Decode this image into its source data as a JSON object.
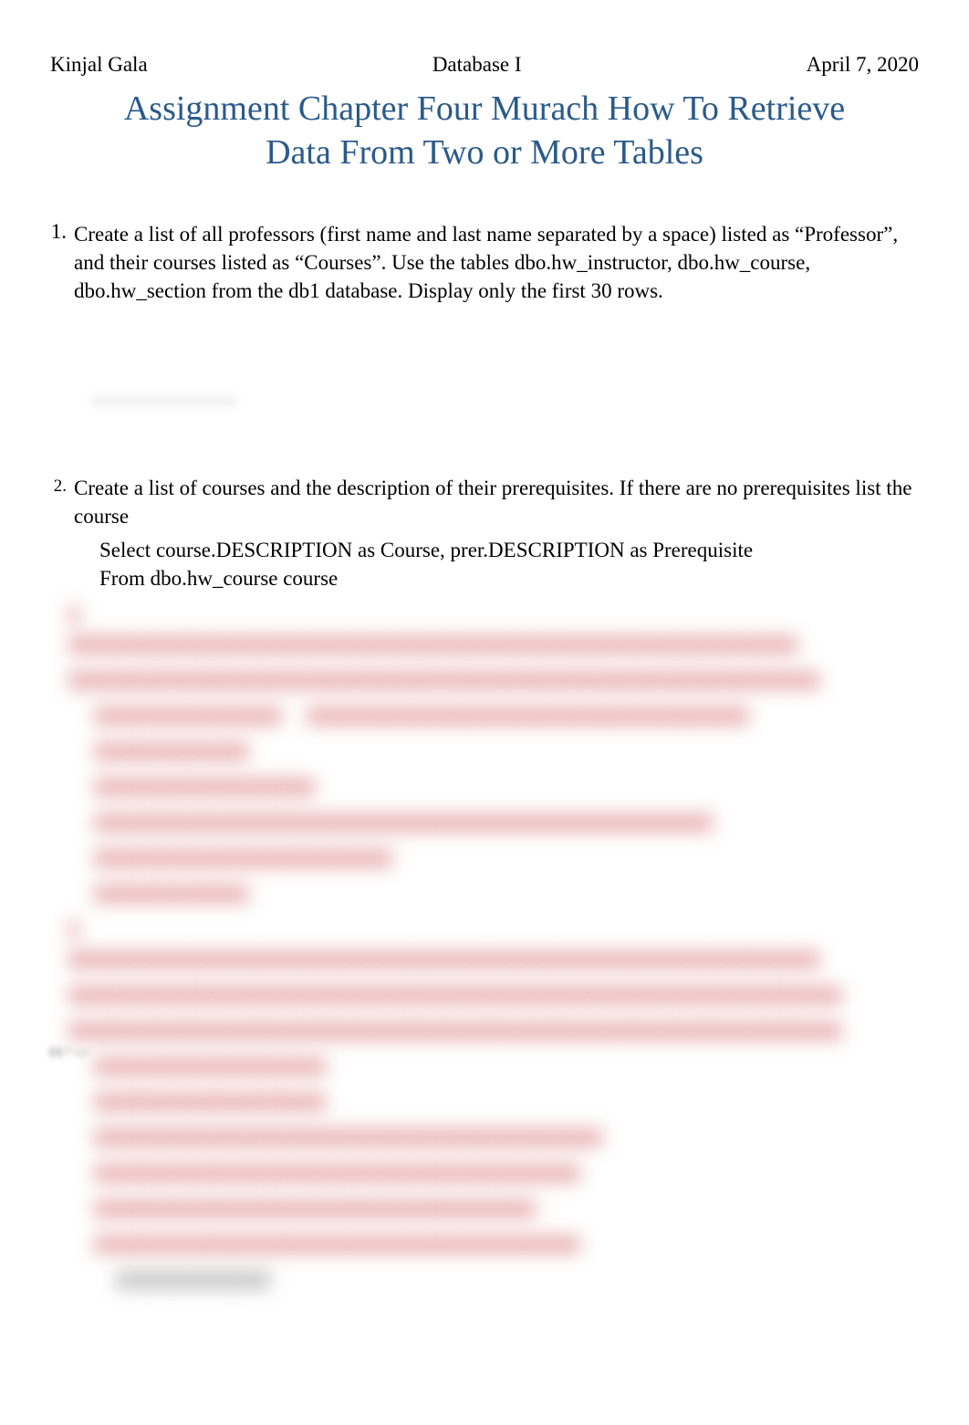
{
  "header": {
    "author": "Kinjal Gala",
    "course": "Database I",
    "date": "April 7, 2020"
  },
  "title": "Assignment Chapter Four Murach How To Retrieve Data From Two or More Tables",
  "questions": {
    "q1": {
      "number": "1.",
      "text": "Create a list of all professors (first name and last name separated by a space) listed as “Professor”, and their courses listed as “Courses”. Use the tables dbo.hw_instructor, dbo.hw_course, dbo.hw_section from the db1 database. Display only the first 30 rows."
    },
    "q2": {
      "number": "2.",
      "text": "Create a list of courses and the description of their prerequisites. If there are no prerequisites list the course",
      "code_line1": "Select course.DESCRIPTION as Course, prer.DESCRIPTION as Prerequisite",
      "code_line2": "From dbo.hw_course course"
    }
  }
}
